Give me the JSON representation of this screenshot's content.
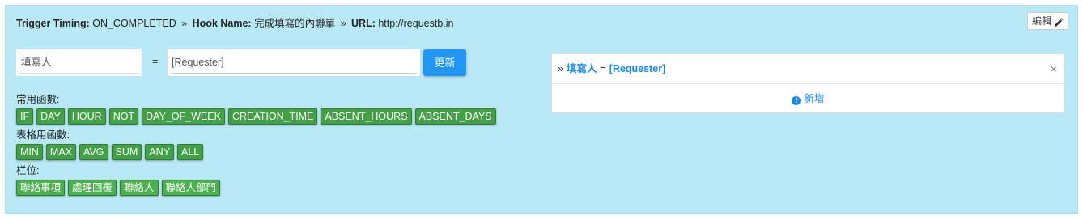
{
  "header": {
    "trigger_label": "Trigger Timing:",
    "trigger_value": "ON_COMPLETED",
    "sep1": "»",
    "hook_label": "Hook Name:",
    "hook_value": "完成填寫的內聯單",
    "sep2": "»",
    "url_label": "URL:",
    "url_value": "http://requestb.in",
    "edit_label": "編輯"
  },
  "mapping_form": {
    "left_value": "填寫人",
    "equals": "=",
    "right_value": "[Requester]",
    "update_label": "更新"
  },
  "functions": {
    "common_label": "常用函數:",
    "common": [
      "IF",
      "DAY",
      "HOUR",
      "NOT",
      "DAY_OF_WEEK",
      "CREATION_TIME",
      "ABSENT_HOURS",
      "ABSENT_DAYS"
    ],
    "table_label": "表格用函數:",
    "table": [
      "MIN",
      "MAX",
      "AVG",
      "SUM",
      "ANY",
      "ALL"
    ],
    "fields_label": "栏位:",
    "fields": [
      "聯絡事項",
      "處理回覆",
      "聯絡人",
      "聯絡人部門"
    ]
  },
  "mapping_card": {
    "marker": "»",
    "key": "填寫人",
    "equals": "=",
    "value": "[Requester]",
    "close": "×",
    "add_label": "新增"
  },
  "colors": {
    "panel_bg": "#b9e9f6",
    "chip_green": "#43a047",
    "button_blue": "#2196f3",
    "link_blue": "#1e88e5"
  }
}
